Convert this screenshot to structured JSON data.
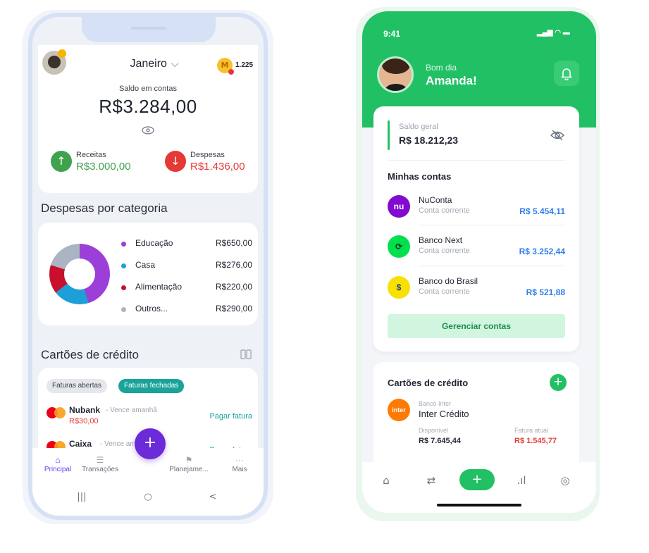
{
  "phone1": {
    "month": "Janeiro",
    "coins": "1.225",
    "saldo_label": "Saldo em contas",
    "saldo": "R$3.284,00",
    "receitas_label": "Receitas",
    "receitas_value": "R$3.000,00",
    "despesas_label": "Despesas",
    "despesas_value": "R$1.436,00",
    "categories_title": "Despesas por categoria",
    "categories": [
      {
        "name": "Educação",
        "value": "R$650,00",
        "color": "#9b3fd8"
      },
      {
        "name": "Casa",
        "value": "R$276,00",
        "color": "#1e9fd8"
      },
      {
        "name": "Alimentação",
        "value": "R$220,00",
        "color": "#c8102e"
      },
      {
        "name": "Outros...",
        "value": "R$290,00",
        "color": "#aab4c3"
      }
    ],
    "cards_title": "Cartões de crédito",
    "chip_open": "Faturas abertas",
    "chip_closed": "Faturas fechadas",
    "cards": [
      {
        "bank": "Nubank",
        "due": "- Vence amanhã",
        "amount": "R$30,00",
        "action": "Pagar fatura"
      },
      {
        "bank": "Caixa",
        "due": "- Vence ama",
        "amount": "",
        "action": "Pagar fatura"
      }
    ],
    "tabs": [
      {
        "label": "Principal"
      },
      {
        "label": "Transações"
      },
      {
        "label": "Planejame..."
      },
      {
        "label": "Mais"
      }
    ],
    "fab": "+",
    "nav": {
      "recents": "|||",
      "home": "○",
      "back": "<"
    }
  },
  "phone2": {
    "time": "9:41",
    "greeting": "Bom dia",
    "name": "Amanda!",
    "balance_label": "Saldo geral",
    "balance": "R$ 18.212,23",
    "accounts_title": "Minhas contas",
    "accounts": [
      {
        "name": "NuConta",
        "type": "Conta corrente",
        "value": "R$ 5.454,11",
        "logo": "nu",
        "color": "#820ad1"
      },
      {
        "name": "Banco Next",
        "type": "Conta corrente",
        "value": "R$ 3.252,44",
        "logo": "⟳",
        "color": "#00e04f"
      },
      {
        "name": "Banco do Brasil",
        "type": "Conta corrente",
        "value": "R$ 521,88",
        "logo": "$",
        "color": "#f8e000"
      }
    ],
    "manage_label": "Gerenciar contas",
    "cards_title": "Cartões de crédito",
    "card": {
      "logo": "inter",
      "issuer": "Banco Inter",
      "name": "Inter Crédito",
      "available_label": "Disponível",
      "available": "R$ 7.645,44",
      "bill_label": "Fatura atual",
      "bill": "R$ 1.545,77"
    },
    "fab": "+",
    "colors": {
      "brand": "#22c064",
      "accent_blue": "#2f80ed",
      "negative": "#e53935"
    }
  }
}
